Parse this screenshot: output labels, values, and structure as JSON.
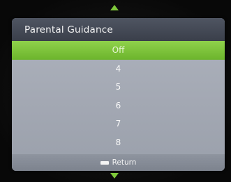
{
  "menu": {
    "title": "Parental Guidance",
    "options": [
      "Off",
      "4",
      "5",
      "6",
      "7",
      "8"
    ],
    "selected": "Off"
  },
  "footer": {
    "return_key_icon": "white-key-icon",
    "return_label": "Return"
  },
  "colors": {
    "selection": "#7ec83a",
    "header": "#434955",
    "panel": "#a6abb6"
  }
}
